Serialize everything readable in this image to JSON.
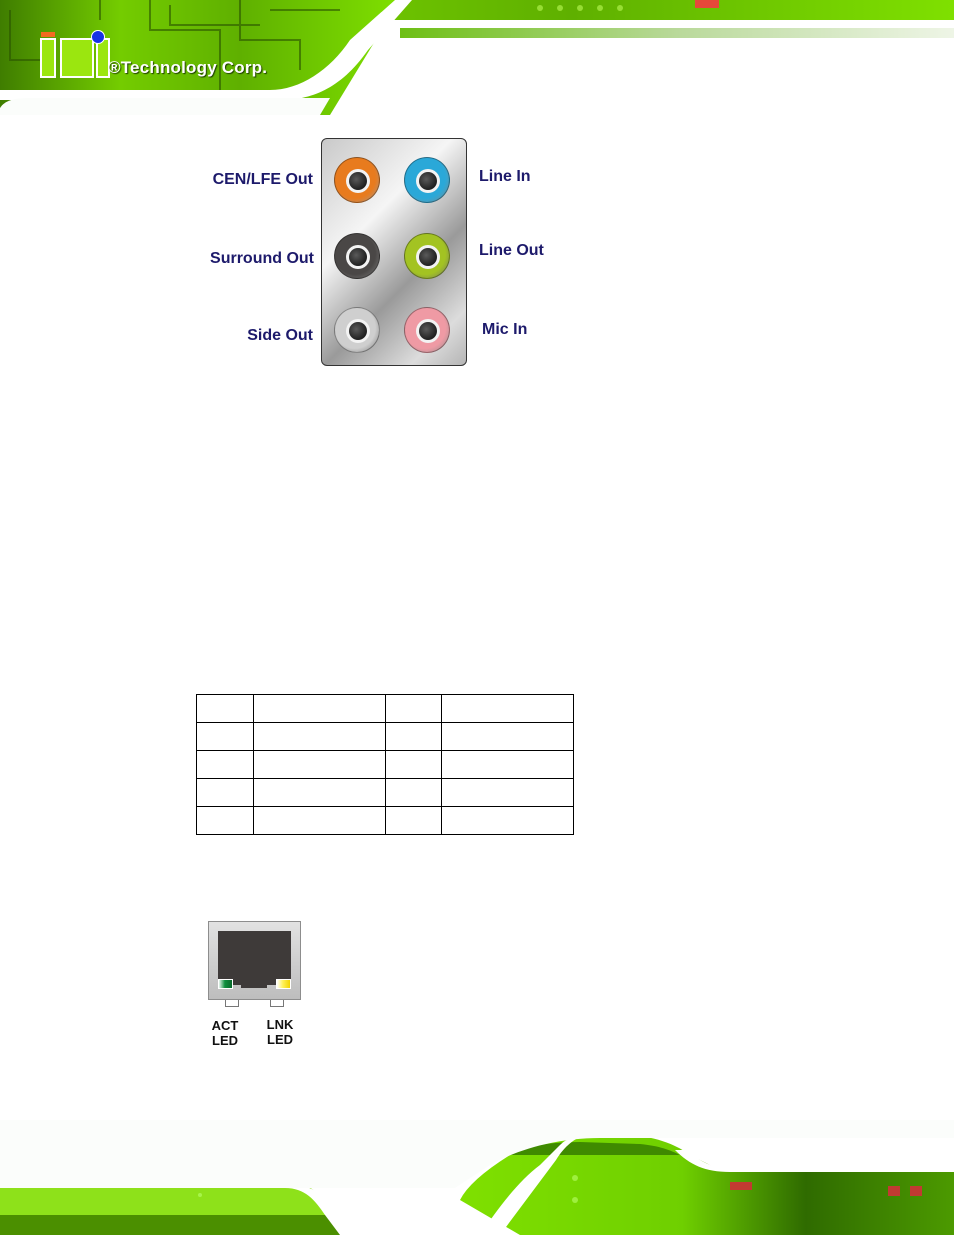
{
  "header": {
    "brand_logo": "iEi",
    "brand_text": "®Technology Corp."
  },
  "audio_figure": {
    "jacks": [
      {
        "label": "CEN/LFE Out",
        "color": "#e87b1e",
        "side": "left"
      },
      {
        "label": "Line In",
        "color": "#2aa8d8",
        "side": "right"
      },
      {
        "label": "Surround Out",
        "color": "#4a4746",
        "side": "left"
      },
      {
        "label": "Line Out",
        "color": "#a3c322",
        "side": "right"
      },
      {
        "label": "Side Out",
        "color": "#cfcfcf",
        "side": "left"
      },
      {
        "label": "Mic In",
        "color": "#ef9aa4",
        "side": "right"
      }
    ]
  },
  "pin_table": {
    "rows": [
      [
        "",
        "",
        "",
        ""
      ],
      [
        "",
        "",
        "",
        ""
      ],
      [
        "",
        "",
        "",
        ""
      ],
      [
        "",
        "",
        "",
        ""
      ],
      [
        "",
        "",
        "",
        ""
      ]
    ]
  },
  "rj45_figure": {
    "act_led_label": [
      "ACT",
      "LED"
    ],
    "lnk_led_label": [
      "LNK",
      "LED"
    ],
    "act_led_color": "#0f8f3d",
    "lnk_led_color": "#fff15a"
  },
  "colors": {
    "brand_green": "#9be60f",
    "label_navy": "#1d1a6b"
  }
}
